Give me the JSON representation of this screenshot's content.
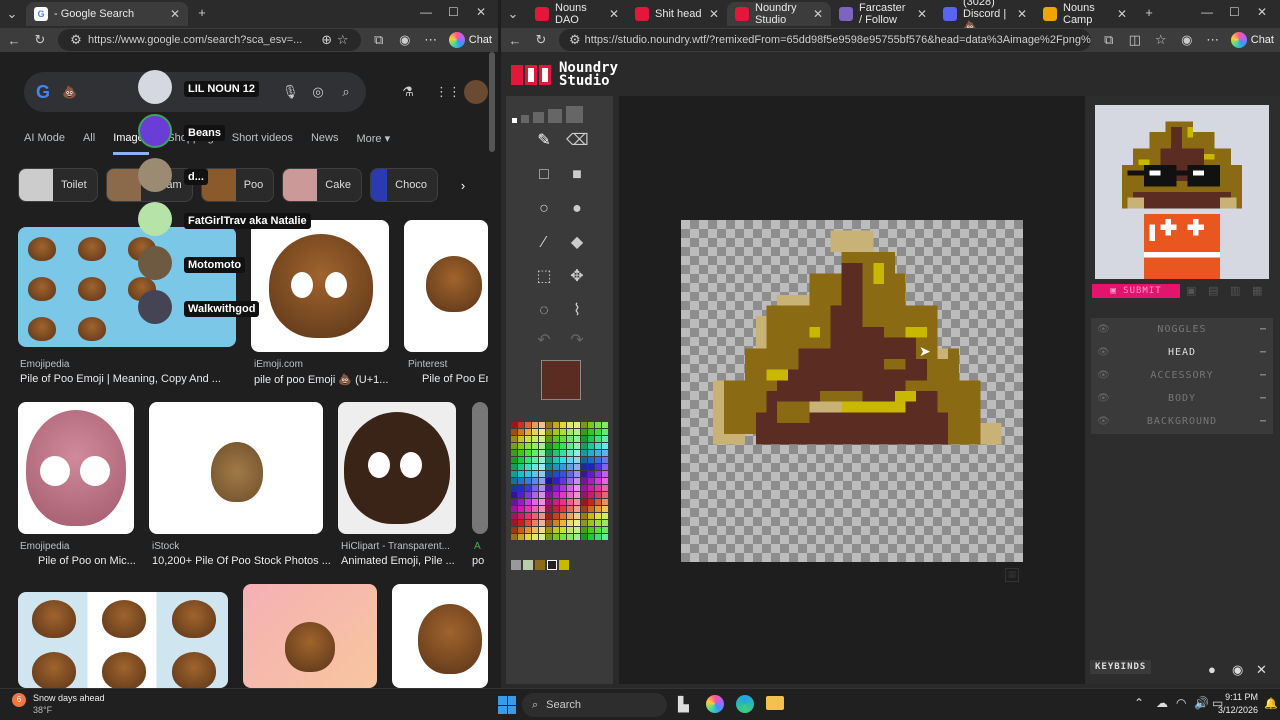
{
  "left_window": {
    "tab_title": "- Google Search",
    "url": "https://www.google.com/search?sca_esv=...",
    "chat_label": "Chat",
    "search_query": "💩",
    "tabs": [
      "AI Mode",
      "All",
      "Images",
      "Shopping",
      "Short videos",
      "News",
      "More"
    ],
    "chips": [
      "Toilet",
      "Cream",
      "Poo",
      "Cake",
      "Choco"
    ],
    "overlay_users": [
      "LIL NOUN 12",
      "Beans",
      "d...",
      "FatGirlTrav aka Natalie",
      "Motomoto",
      "Walkwithgod"
    ],
    "results": [
      {
        "source": "Emojipedia",
        "caption": "Pile of Poo Emoji | Meaning, Copy And ..."
      },
      {
        "source": "iEmoji.com",
        "caption": "pile of poo Emoji 💩 (U+1..."
      },
      {
        "source": "Pinterest",
        "caption": "Pile of Poo Em"
      },
      {
        "source": "Emojipedia",
        "caption": "Pile of Poo on Mic..."
      },
      {
        "source": "iStock",
        "caption": "10,200+ Pile Of Poo Stock Photos ..."
      },
      {
        "source": "HiClipart - Transparent...",
        "caption": "Animated Emoji, Pile ..."
      },
      {
        "source": "A",
        "caption": "po"
      }
    ]
  },
  "right_window": {
    "tabs": [
      {
        "label": "Nouns DAO",
        "color": "#e4163a"
      },
      {
        "label": "Shit head",
        "color": "#e4163a"
      },
      {
        "label": "Noundry Studio",
        "color": "#e4163a"
      },
      {
        "label": "Farcaster / Follow",
        "color": "#7c65c1"
      },
      {
        "label": "(3028) Discord | 💩",
        "color": "#5865f2"
      },
      {
        "label": "Nouns Camp",
        "color": "#f0a500"
      }
    ],
    "url": "https://studio.noundry.wtf/?remixedFrom=65dd98f5e9598e95755bf576&head=data%3Aimage%2Fpng%3Bbase64...",
    "chat_label": "Chat",
    "brand": {
      "line1": "Noundry",
      "line2": "Studio"
    },
    "submit_label": "SUBMIT",
    "layers": [
      "NOGGLES",
      "HEAD",
      "ACCESSORY",
      "BODY",
      "BACKGROUND"
    ],
    "selected_layer": "HEAD",
    "keybinds_label": "KEYBINDS",
    "current_color": "#5a2c22"
  },
  "taskbar": {
    "weather_title": "Snow days ahead",
    "weather_temp": "38°F",
    "search_placeholder": "Search",
    "time": "9:11 PM",
    "date": "3/12/2026",
    "notification_count": "6"
  }
}
